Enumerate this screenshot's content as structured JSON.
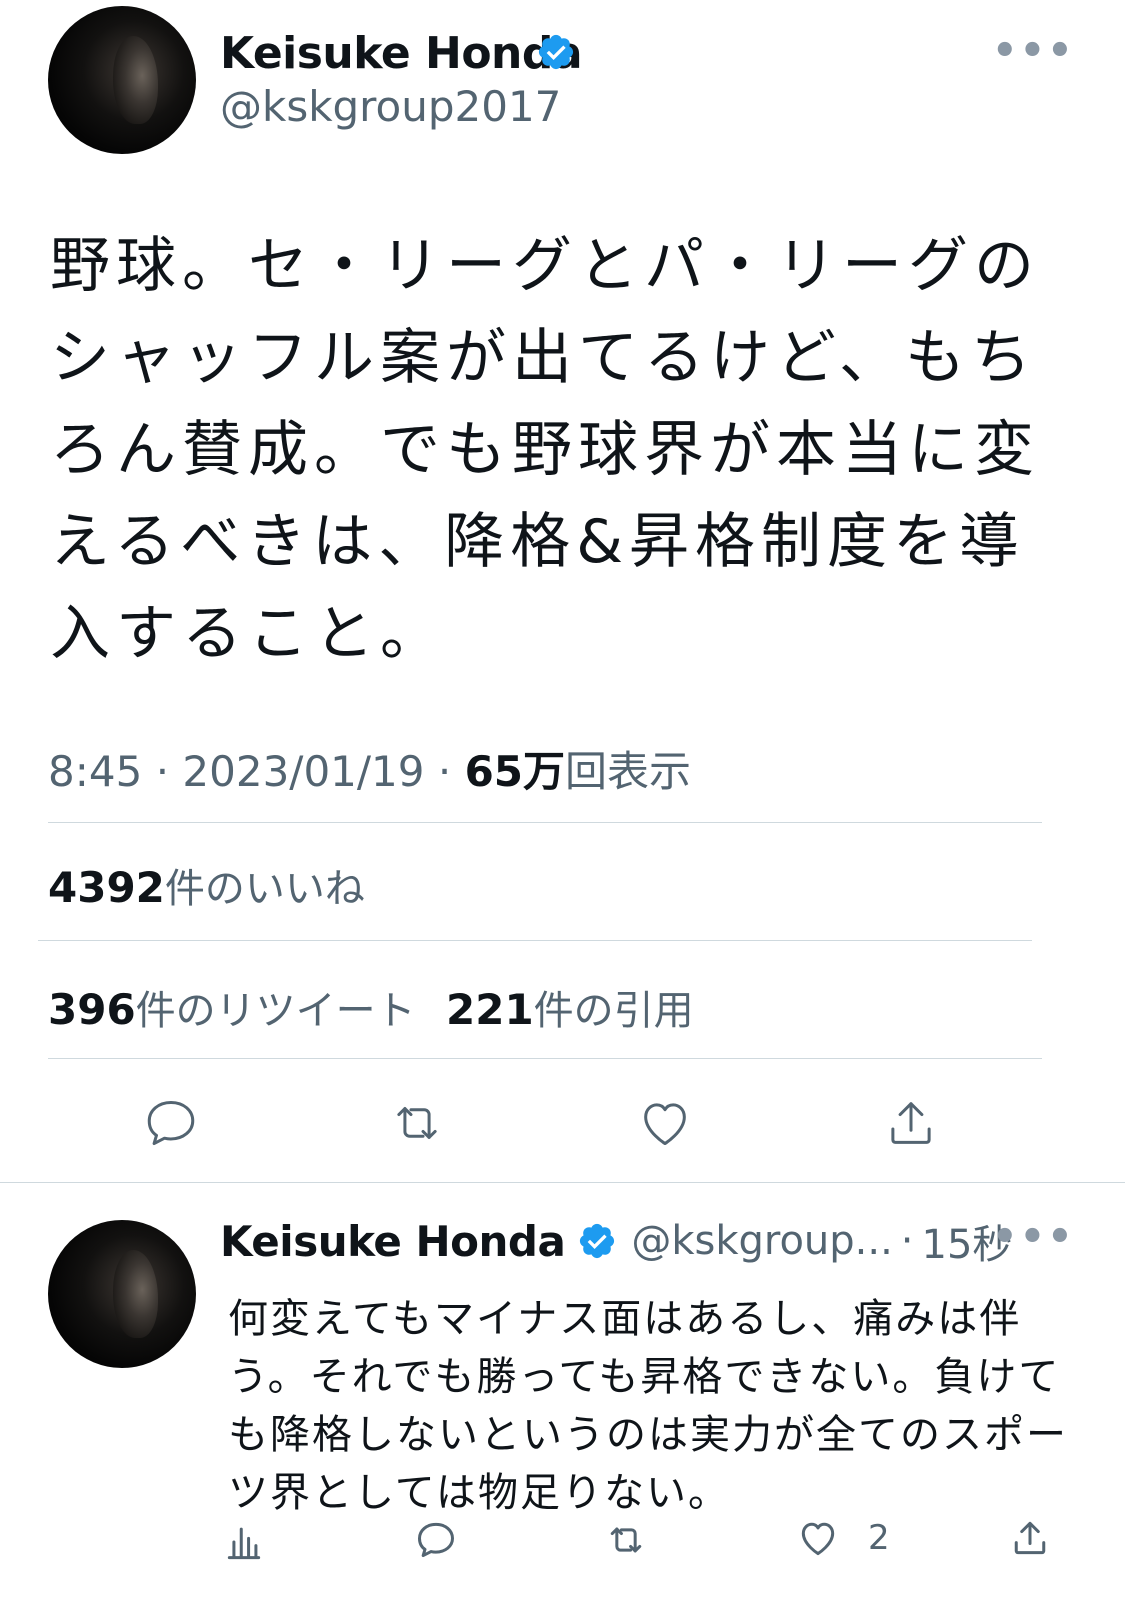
{
  "main_tweet": {
    "author_name": "Keisuke Honda",
    "author_handle": "@kskgroup2017",
    "text": "野球。セ・リーグとパ・リーグのシャッフル案が出てるけど、もちろん賛成。でも野球界が本当に変えるべきは、降格&昇格制度を導入すること。",
    "time": "8:45",
    "date": "2023/01/19",
    "views_count": "65万",
    "views_label": "回表示",
    "likes_count": "4392",
    "likes_label": "件のいいね",
    "retweets_count": "396",
    "retweets_label": "件のリツイート",
    "quotes_count": "221",
    "quotes_label": "件の引用",
    "separator": "·"
  },
  "reply_tweet": {
    "author_name": "Keisuke Honda",
    "author_handle": "@kskgroup...",
    "time_ago": "15秒",
    "separator": "·",
    "text": "何変えてもマイナス面はあるし、痛みは伴う。それでも勝っても昇格できない。負けても降格しないというのは実力が全てのスポーツ界としては物足りない。",
    "like_count": "2"
  },
  "icons": {
    "verified": "verified-badge-icon",
    "more": "more-options-icon",
    "reply": "reply-icon",
    "retweet": "retweet-icon",
    "like": "heart-icon",
    "share": "share-icon",
    "analytics": "analytics-icon"
  },
  "colors": {
    "verified_blue": "#1d9bf0",
    "secondary_text": "#536471",
    "primary_text": "#0f1419",
    "divider": "#cfd9de"
  }
}
